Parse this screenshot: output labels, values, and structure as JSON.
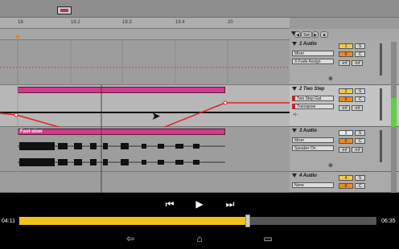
{
  "ruler": {
    "marks": [
      "18",
      "19.2",
      "19.3",
      "19.4",
      "20"
    ]
  },
  "top_buttons": {
    "set_label": "Set"
  },
  "tracks": [
    {
      "name": "1 Audio",
      "input": "Mixer",
      "output": "X-Fade Assign",
      "number": "1",
      "solo": "S",
      "pan": "0",
      "cue": "C",
      "vol_l": "-inf",
      "vol_r": "-inf",
      "number_color": "#f2c94c"
    },
    {
      "name": "2 Two Step",
      "input": "Two Step Gat",
      "output": "Transpose",
      "number": "2",
      "solo": "S",
      "pan": "0",
      "cue": "C",
      "vol_l": "-inf",
      "vol_r": "-inf",
      "number_color": "#f2c94c"
    },
    {
      "name": "3 Audio",
      "input": "Mixer",
      "output": "Speaker On",
      "number": "3",
      "solo": "S",
      "pan": "0",
      "cue": "C",
      "vol_l": "-inf",
      "vol_r": "-inf",
      "number_color": "#e8e8e8"
    },
    {
      "name": "4 Audio",
      "input": "None",
      "output": "",
      "number": "4",
      "solo": "S",
      "pan": "0",
      "cue": "C",
      "vol_l": "",
      "vol_r": "",
      "number_color": "#f2c94c"
    }
  ],
  "clips": {
    "track3_label": "Fast-slow"
  },
  "player": {
    "elapsed": "04:11",
    "duration": "06:35",
    "progress": 0.64,
    "prev_icon": "skip-previous-icon",
    "play_icon": "play-icon",
    "next_icon": "skip-next-icon"
  },
  "nav": {
    "back_icon": "back-icon",
    "home_icon": "home-icon",
    "recents_icon": "recents-icon"
  },
  "colors": {
    "clip": "#d23a8e",
    "automation": "#e02020",
    "seek": "#f3c21a",
    "pan": "#f08a1c"
  }
}
